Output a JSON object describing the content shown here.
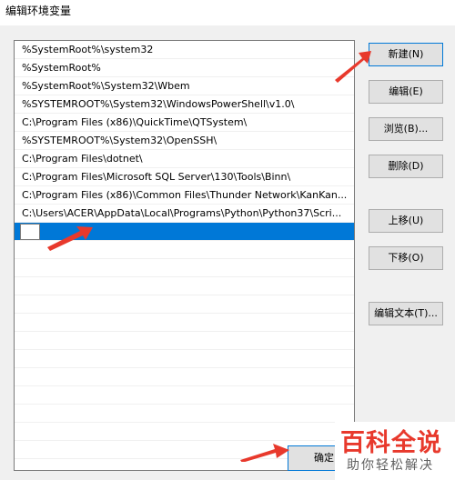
{
  "window": {
    "title": "编辑环境变量"
  },
  "paths": [
    "%SystemRoot%\\system32",
    "%SystemRoot%",
    "%SystemRoot%\\System32\\Wbem",
    "%SYSTEMROOT%\\System32\\WindowsPowerShell\\v1.0\\",
    "C:\\Program Files (x86)\\QuickTime\\QTSystem\\",
    "%SYSTEMROOT%\\System32\\OpenSSH\\",
    "C:\\Program Files\\dotnet\\",
    "C:\\Program Files\\Microsoft SQL Server\\130\\Tools\\Binn\\",
    "C:\\Program Files (x86)\\Common Files\\Thunder Network\\KanKan...",
    "C:\\Users\\ACER\\AppData\\Local\\Programs\\Python\\Python37\\Scri..."
  ],
  "buttons": {
    "new": "新建(N)",
    "edit": "编辑(E)",
    "browse": "浏览(B)...",
    "delete": "删除(D)",
    "move_up": "上移(U)",
    "move_down": "下移(O)",
    "edit_text": "编辑文本(T)...",
    "ok": "确定"
  },
  "watermark": {
    "main": "百科全说",
    "sub": "助你轻松解决"
  },
  "colors": {
    "selection": "#0078d7",
    "arrow": "#e8392c",
    "watermark_red": "#e8392c"
  }
}
